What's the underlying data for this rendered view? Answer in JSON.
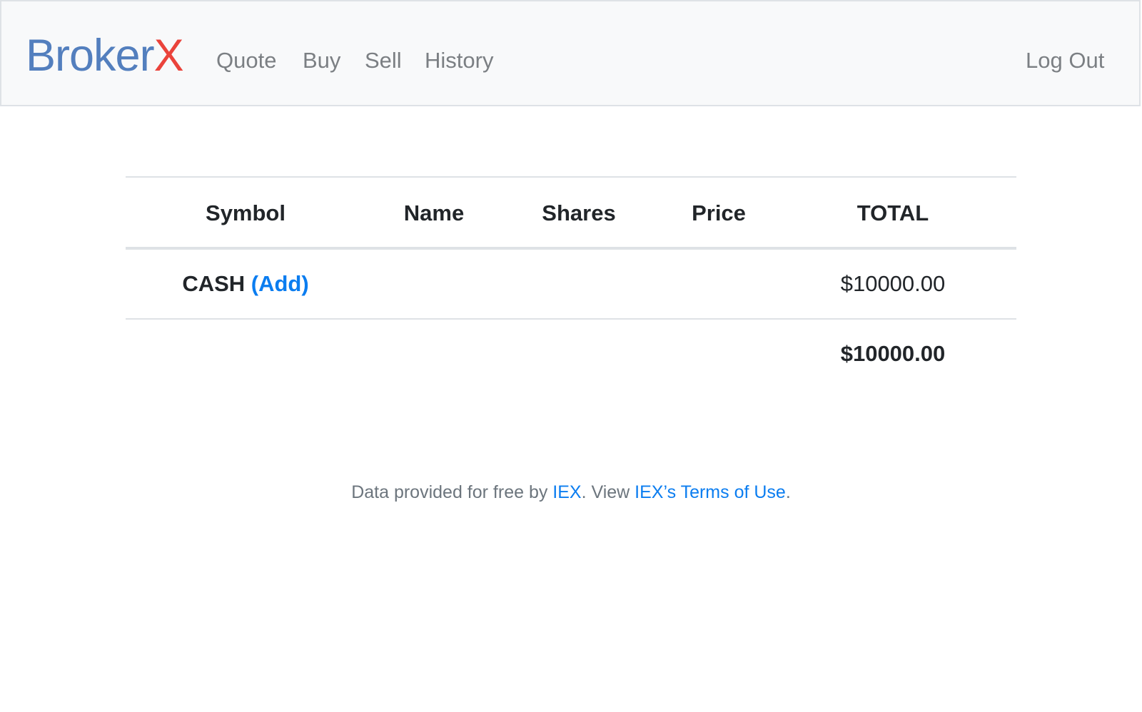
{
  "navbar": {
    "brand_part1": "Broker",
    "brand_part2": "X",
    "links": [
      "Quote",
      "Buy",
      "Sell",
      "History"
    ],
    "logout_label": "Log Out"
  },
  "table": {
    "headers": [
      "Symbol",
      "Name",
      "Shares",
      "Price",
      "TOTAL"
    ],
    "cash_row": {
      "symbol": "CASH",
      "add_link": "(Add)",
      "total": "$10000.00"
    },
    "grand_total": "$10000.00"
  },
  "footer": {
    "text_before": "Data provided for free by ",
    "iex_link": "IEX",
    "text_middle": ". View ",
    "terms_link": "IEX’s Terms of Use",
    "text_after": "."
  },
  "colors": {
    "brand_blue": "#537fbe",
    "brand_red": "#ea433b",
    "link_blue": "#0b7df0",
    "nav_gray": "#7b7f83",
    "navbar_bg": "#f8f9fa"
  }
}
